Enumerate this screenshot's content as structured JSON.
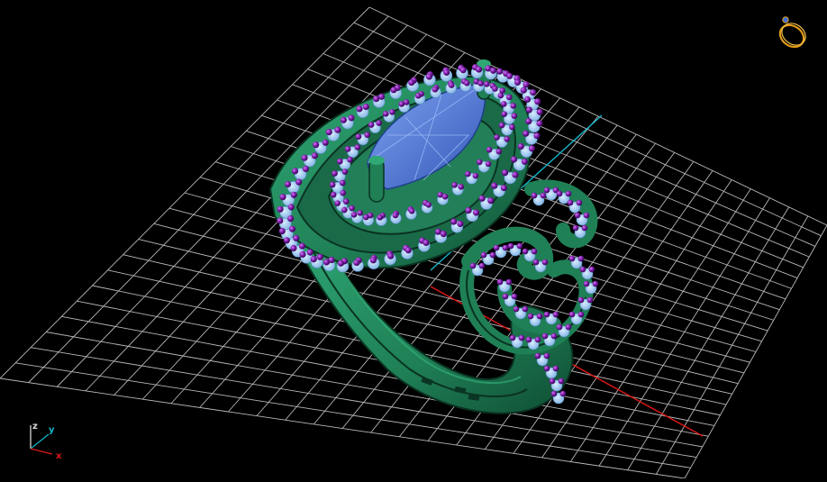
{
  "viewport": {
    "background": "#000000",
    "grid_color": "#d8d8d8",
    "grid_spacing_label": "",
    "axes_colors": {
      "x": "#e01818",
      "y": "#14b4c8",
      "z": "#1e8f5a"
    }
  },
  "model": {
    "type": "marquise halo ring",
    "metal_color": "#1f7f55",
    "metal_highlight": "#2fa874",
    "center_stone_color": "#4a73d8",
    "stone_seat_color": "#9cc6ee",
    "prong_bead_color": "#7d1aa8"
  },
  "axis_triad": {
    "labels": {
      "x": "x",
      "y": "y",
      "z": "z"
    },
    "colors": {
      "x": "#e01818",
      "y": "#14b4c8",
      "z": "#d8d8d8"
    }
  },
  "view_cube": {
    "icon": "ring-view-icon",
    "color": "#e09a18"
  }
}
